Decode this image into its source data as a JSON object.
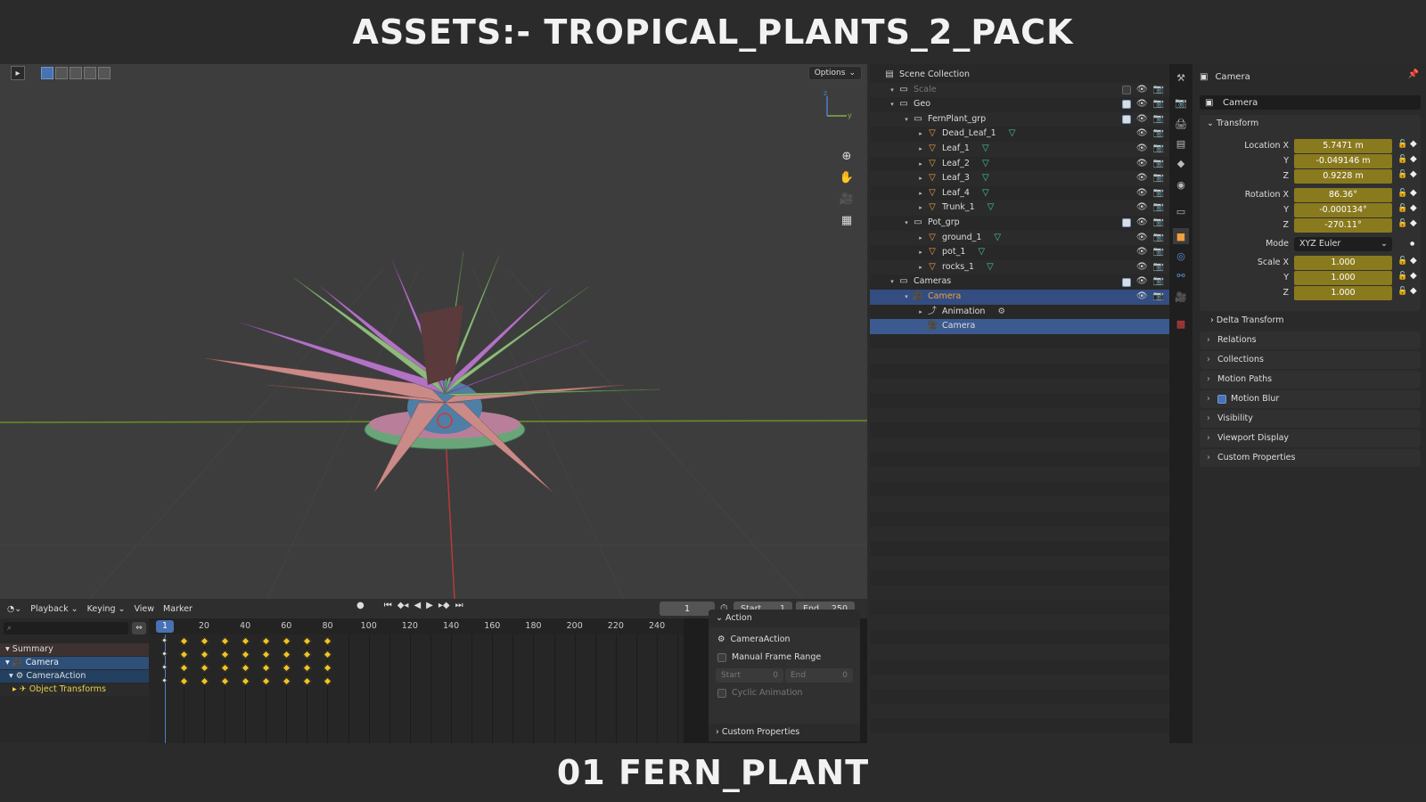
{
  "banner": {
    "top": "ASSETS:- TROPICAL_PLANTS_2_PACK",
    "bottom": "01 FERN_PLANT"
  },
  "viewport": {
    "options_label": "Options"
  },
  "timeline": {
    "menus": [
      "Playback",
      "Keying",
      "View",
      "Marker"
    ],
    "current_frame": "1",
    "start_label": "Start",
    "start_value": "1",
    "end_label": "End",
    "end_value": "250",
    "ruler": [
      "1",
      "20",
      "40",
      "60",
      "80",
      "100",
      "120",
      "140",
      "160",
      "180",
      "200",
      "220",
      "240"
    ],
    "channels": [
      "Summary",
      "Camera",
      "CameraAction",
      "Object Transforms"
    ],
    "keyframes": [
      1,
      10,
      20,
      30,
      40,
      50,
      60,
      70,
      80
    ]
  },
  "action_panel": {
    "title": "Action",
    "action_name": "CameraAction",
    "manual_frame_range": "Manual Frame Range",
    "start_label": "Start",
    "start_value": "0",
    "end_label": "End",
    "end_value": "0",
    "cyclic": "Cyclic Animation",
    "custom_props": "Custom Properties"
  },
  "outliner": {
    "rows": [
      {
        "label": "Scene Collection",
        "indent": 0,
        "type": "scene"
      },
      {
        "label": "Scale",
        "indent": 1,
        "type": "coll",
        "dim": true
      },
      {
        "label": "Geo",
        "indent": 1,
        "type": "coll"
      },
      {
        "label": "FernPlant_grp",
        "indent": 2,
        "type": "coll"
      },
      {
        "label": "Dead_Leaf_1",
        "indent": 3,
        "type": "mesh"
      },
      {
        "label": "Leaf_1",
        "indent": 3,
        "type": "mesh"
      },
      {
        "label": "Leaf_2",
        "indent": 3,
        "type": "mesh"
      },
      {
        "label": "Leaf_3",
        "indent": 3,
        "type": "mesh"
      },
      {
        "label": "Leaf_4",
        "indent": 3,
        "type": "mesh"
      },
      {
        "label": "Trunk_1",
        "indent": 3,
        "type": "mesh"
      },
      {
        "label": "Pot_grp",
        "indent": 2,
        "type": "coll"
      },
      {
        "label": "ground_1",
        "indent": 3,
        "type": "mesh"
      },
      {
        "label": "pot_1",
        "indent": 3,
        "type": "mesh"
      },
      {
        "label": "rocks_1",
        "indent": 3,
        "type": "mesh"
      },
      {
        "label": "Cameras",
        "indent": 1,
        "type": "coll"
      },
      {
        "label": "Camera",
        "indent": 2,
        "type": "camera"
      },
      {
        "label": "Animation",
        "indent": 3,
        "type": "anim"
      },
      {
        "label": "Camera",
        "indent": 3,
        "type": "camdata"
      }
    ]
  },
  "properties": {
    "header": "Camera",
    "object_name": "Camera",
    "transform_title": "Transform",
    "location": {
      "label": "Location X",
      "x": "5.7471 m",
      "y": "-0.049146 m",
      "z": "0.9228 m"
    },
    "rotation": {
      "label": "Rotation X",
      "x": "86.36°",
      "y": "-0.000134°",
      "z": "-270.11°"
    },
    "mode_label": "Mode",
    "mode_value": "XYZ Euler",
    "scale": {
      "label": "Scale X",
      "x": "1.000",
      "y": "1.000",
      "z": "1.000"
    },
    "axis_y": "Y",
    "axis_z": "Z",
    "delta": "Delta Transform",
    "sections": [
      "Relations",
      "Collections",
      "Motion Paths",
      "Motion Blur",
      "Visibility",
      "Viewport Display",
      "Custom Properties"
    ]
  }
}
